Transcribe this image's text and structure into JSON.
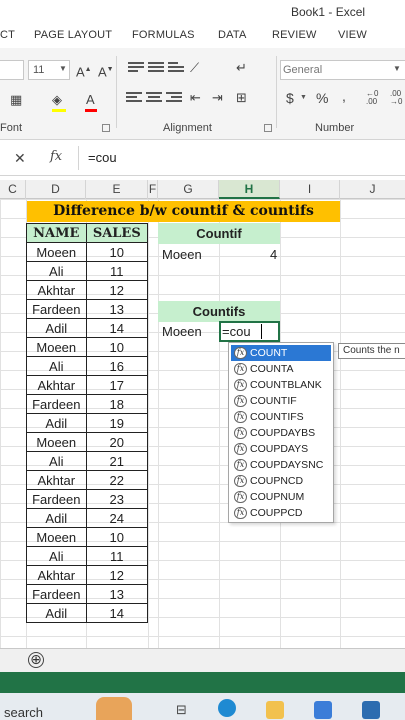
{
  "window": {
    "title": "Book1 - Excel"
  },
  "ribbon_tabs": [
    "CT",
    "PAGE LAYOUT",
    "FORMULAS",
    "DATA",
    "REVIEW",
    "VIEW"
  ],
  "ribbon": {
    "font_size": "11",
    "number_format": "General",
    "groups": [
      "Font",
      "Alignment",
      "Number"
    ],
    "number_symbols": {
      "currency": "$",
      "percent": "%",
      "comma": ","
    }
  },
  "formula_bar": {
    "cancel": "✕",
    "fx": "fx",
    "formula": "=cou"
  },
  "columns": [
    "C",
    "D",
    "E",
    "F",
    "G",
    "H",
    "I",
    "J"
  ],
  "selected_column": "H",
  "sheet": {
    "banner": "Difference b/w countif & countifs",
    "table_headers": [
      "NAME",
      "SALES"
    ],
    "rows": [
      [
        "Moeen",
        "10"
      ],
      [
        "Ali",
        "11"
      ],
      [
        "Akhtar",
        "12"
      ],
      [
        "Fardeen",
        "13"
      ],
      [
        "Adil",
        "14"
      ],
      [
        "Moeen",
        "10"
      ],
      [
        "Ali",
        "16"
      ],
      [
        "Akhtar",
        "17"
      ],
      [
        "Fardeen",
        "18"
      ],
      [
        "Adil",
        "19"
      ],
      [
        "Moeen",
        "20"
      ],
      [
        "Ali",
        "21"
      ],
      [
        "Akhtar",
        "22"
      ],
      [
        "Fardeen",
        "23"
      ],
      [
        "Adil",
        "24"
      ],
      [
        "Moeen",
        "10"
      ],
      [
        "Ali",
        "11"
      ],
      [
        "Akhtar",
        "12"
      ],
      [
        "Fardeen",
        "13"
      ],
      [
        "Adil",
        "14"
      ]
    ],
    "countif": {
      "label": "Countif",
      "name": "Moeen",
      "result": "4"
    },
    "countifs": {
      "label": "Countifs",
      "name": "Moeen",
      "formula": "=cou"
    }
  },
  "autocomplete": {
    "items": [
      "COUNT",
      "COUNTA",
      "COUNTBLANK",
      "COUNTIF",
      "COUNTIFS",
      "COUPDAYBS",
      "COUPDAYS",
      "COUPDAYSNC",
      "COUPNCD",
      "COUPNUM",
      "COUPPCD"
    ],
    "highlighted": "COUNT",
    "tooltip": "Counts the n"
  },
  "sheet_tabs": {
    "add": "⊕"
  },
  "taskbar": {
    "search": "search"
  },
  "colors": {
    "accent": "#217346",
    "banner": "#ffc000",
    "header_green": "#c6efce",
    "highlight": "#2b78d4"
  }
}
